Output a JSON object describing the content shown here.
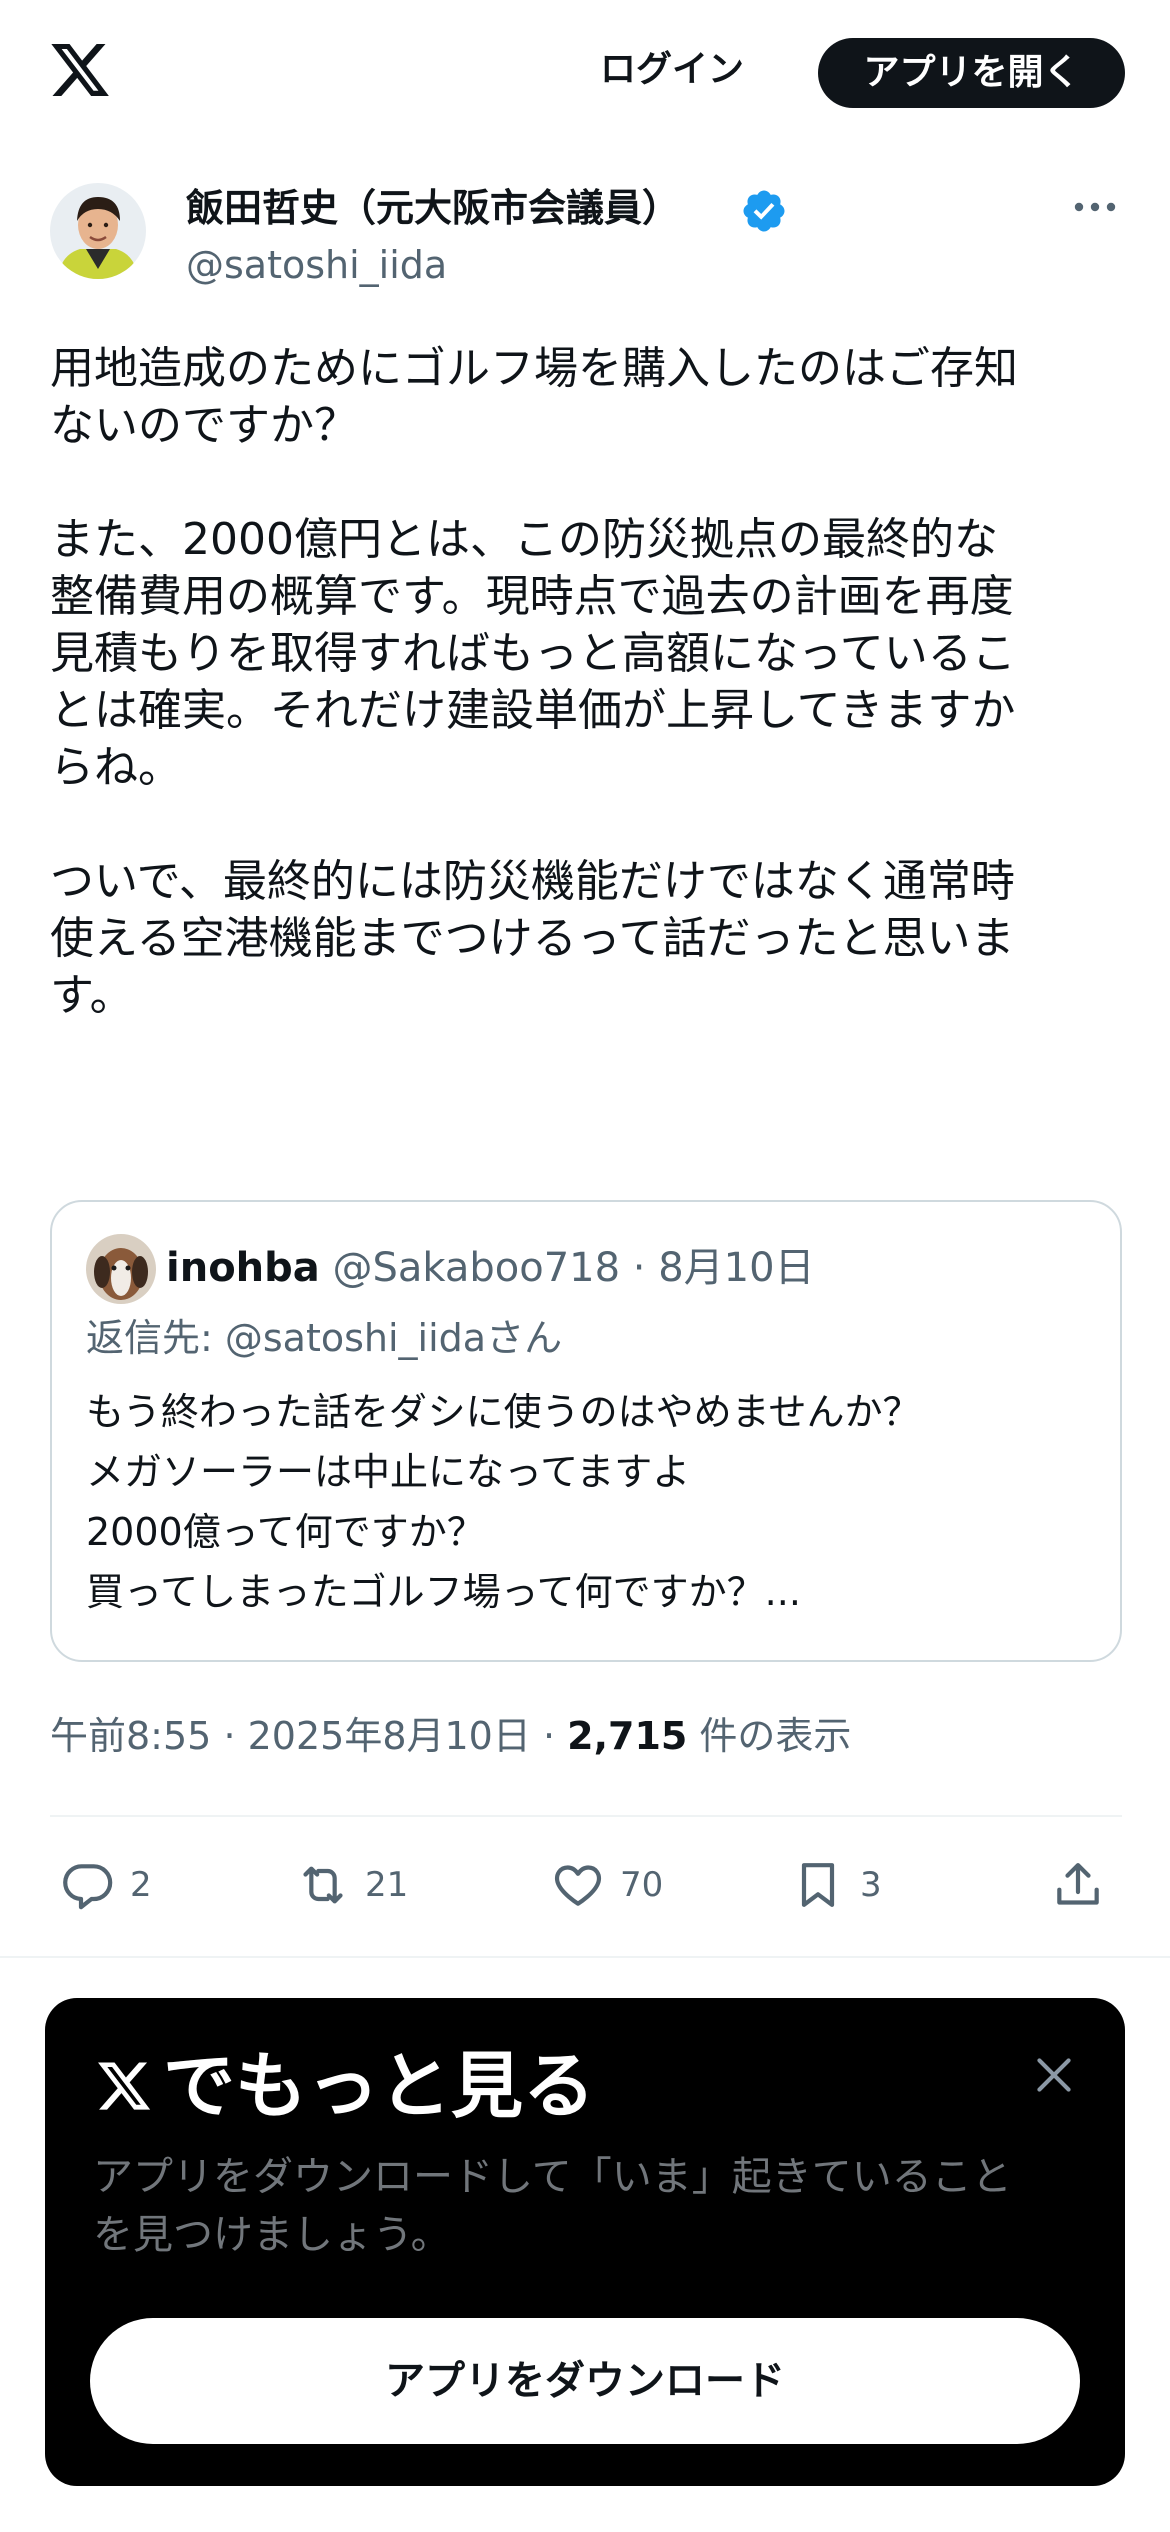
{
  "header": {
    "login_label": "ログイン",
    "open_app_label": "アプリを開く"
  },
  "tweet": {
    "author_name": "飯田哲史（元大阪市会議員）",
    "author_handle": "@satoshi_iida",
    "text": "用地造成のためにゴルフ場を購入したのはご存知\nないのですか？\n\nまた、2000億円とは、この防災拠点の最終的な\n整備費用の概算です。現時点で過去の計画を再度\n見積もりを取得すればもっと高額になっているこ\nとは確実。それだけ建設単価が上昇してきますか\nらね。\n\nついで、最終的には防災機能だけではなく通常時\n使える空港機能までつけるって話だったと思いま\nす。",
    "time": "午前8:55",
    "date": "2025年8月10日",
    "views_count": "2,715",
    "views_label": "件の表示"
  },
  "quote": {
    "name": "inohba",
    "handle": "@Sakaboo718",
    "date": "8月10日",
    "reply_to": "返信先: @satoshi_iidaさん",
    "text": "もう終わった話をダシに使うのはやめませんか？\nメガソーラーは中止になってますよ\n2000億って何ですか？\n買ってしまったゴルフ場って何ですか？..."
  },
  "actions": {
    "replies": "2",
    "reposts": "21",
    "likes": "70",
    "bookmarks": "3"
  },
  "promo": {
    "title": "でもっと見る",
    "description": "アプリをダウンロードして「いま」起きていること\nを見つけましょう。",
    "button_label": "アプリをダウンロード"
  },
  "colors": {
    "text_primary": "#0f1419",
    "text_secondary": "#536471",
    "verified_blue": "#1d9bf0",
    "border": "#cfd9de",
    "promo_bg": "#000000"
  }
}
